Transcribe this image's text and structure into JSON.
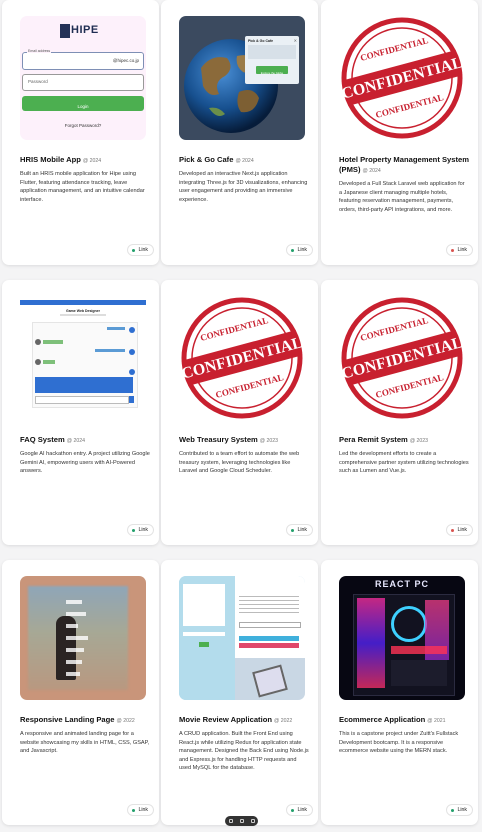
{
  "projects": [
    {
      "title": "HRIS Mobile App",
      "year": "@ 2024",
      "desc": "Built an HRIS mobile application for Hipe using Flutter, featuring attendance tracking, leave application management, and an intuitive calendar interface.",
      "link": "Link",
      "link_color": "#22a06b"
    },
    {
      "title": "Pick & Go Cafe",
      "year": "@ 2024",
      "desc": "Developed an interactive Next.js application integrating Three.js for 3D visualizations, enhancing user engagement and providing an immersive experience.",
      "link": "Link",
      "link_color": "#22a06b"
    },
    {
      "title": "Hotel Property Management System (PMS)",
      "year": "@ 2024",
      "desc": "Developed a Full Stack Laravel web application for a Japanese client managing multiple hotels, featuring reservation management, payments, orders, third-party API integrations, and more.",
      "link": "Link",
      "link_color": "#d9534f"
    },
    {
      "title": "FAQ System",
      "year": "@ 2024",
      "desc": "Google AI hackathon entry. A project utilizing Google Gemini AI, empowering users with AI-Powered answers.",
      "link": "Link",
      "link_color": "#22a06b"
    },
    {
      "title": "Web Treasury System",
      "year": "@ 2023",
      "desc": "Contributed to a team effort to automate the web treasury system, leveraging technologies like Laravel and Google Cloud Scheduler.",
      "link": "Link",
      "link_color": "#22a06b"
    },
    {
      "title": "Pera Remit System",
      "year": "@ 2023",
      "desc": "Led the development efforts to create a comprehensive partner system utilizing technologies such as Lumen and Vue.js.",
      "link": "Link",
      "link_color": "#d9534f"
    },
    {
      "title": "Responsive Landing Page",
      "year": "@ 2022",
      "desc": "A responsive and animated landing page for a website showcasing my skills in HTML, CSS, GSAP, and Javascript.",
      "link": "Link",
      "link_color": "#22a06b"
    },
    {
      "title": "Movie Review Application",
      "year": "@ 2022",
      "desc": "A CRUD application. Built the Front End using React.js while utilizing Redux for application state management. Designed the Back End using Node.js and Express.js for handling HTTP requests and used MySQL for the database.",
      "link": "Link",
      "link_color": "#22a06b"
    },
    {
      "title": "Ecommerce Application",
      "year": "@ 2021",
      "desc": "This is a capstone project under Zuitt's Fullstack Development bootcamp. It is a responsive ecommerce website using the MERN stack.",
      "link": "Link",
      "link_color": "#22a06b"
    }
  ],
  "thumbs": {
    "hris": {
      "logo": "HIPE",
      "email_label": "Email address",
      "email_value": "@hipec.co.jp",
      "password_placeholder": "Password",
      "login": "Login",
      "forgot": "Forgot Password?"
    },
    "cafe": {
      "popup_title": "Pick & Go Cafe",
      "popup_button": "Explore the Globe"
    },
    "faq": {
      "header": "Game Web Designer"
    },
    "stamp": {
      "text": "CONFIDENTIAL"
    },
    "ecom": {
      "banner": "REACT PC"
    },
    "movie": {
      "add_label": "Add Review"
    }
  },
  "colors": {
    "accent_green": "#4caf50",
    "stamp_red": "#c8202f",
    "page_bg": "#f4f4f5"
  }
}
